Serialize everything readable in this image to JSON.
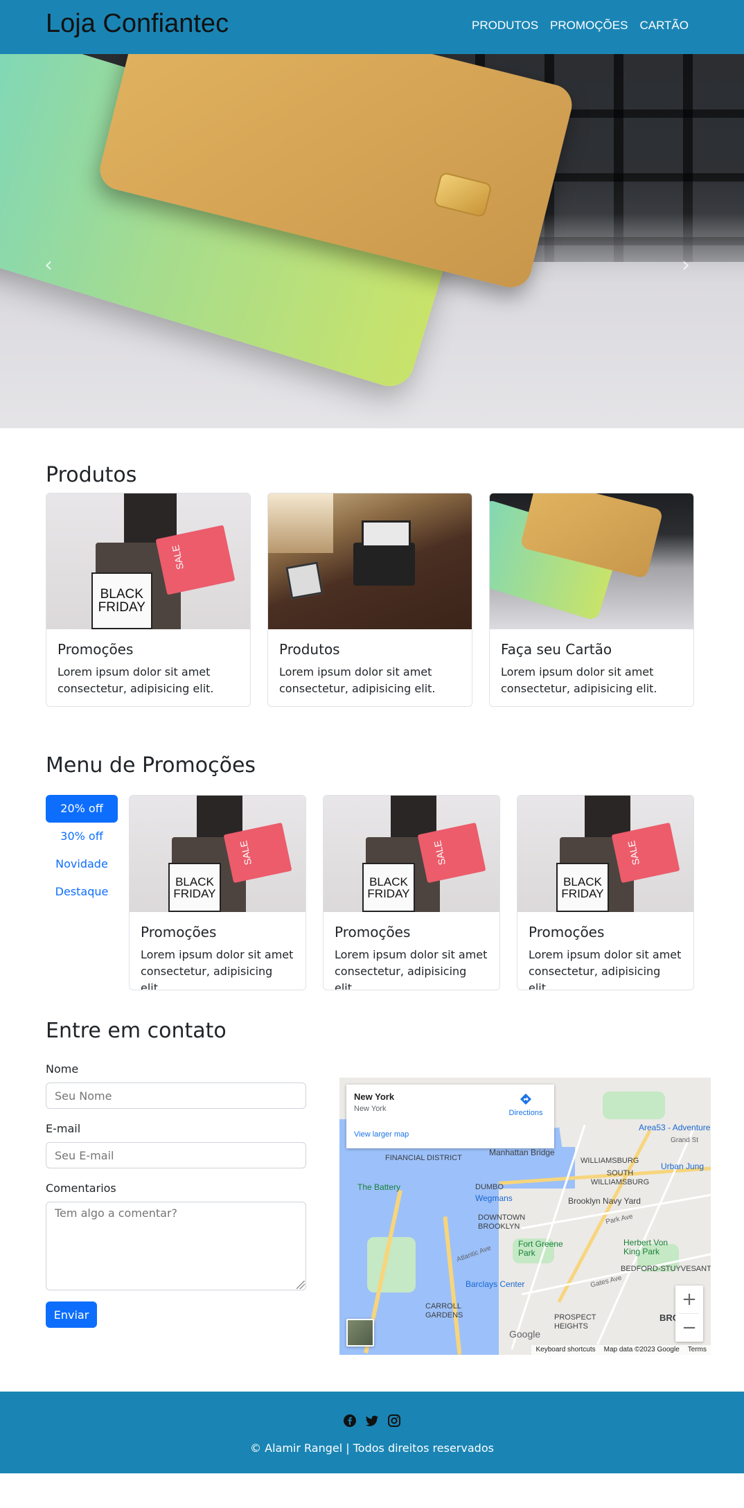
{
  "header": {
    "brand": "Loja Confiantec",
    "nav": [
      "PRODUTOS",
      "PROMOÇÕES",
      "CARTÃO"
    ]
  },
  "hero": {
    "prev_glyph": "‹",
    "next_glyph": "›"
  },
  "produtos": {
    "heading": "Produtos",
    "cards": [
      {
        "title": "Promoções",
        "text": "Lorem ipsum dolor sit amet consectetur, adipisicing elit.",
        "image_text": "BLACK FRIDAY",
        "sale": "SALE"
      },
      {
        "title": "Produtos",
        "text": "Lorem ipsum dolor sit amet consectetur, adipisicing elit."
      },
      {
        "title": "Faça seu Cartão",
        "text": "Lorem ipsum dolor sit amet consectetur, adipisicing elit."
      }
    ]
  },
  "promocoes": {
    "heading": "Menu de Promoções",
    "pills": [
      "20% off",
      "30% off",
      "Novidade",
      "Destaque"
    ],
    "active_pill": "20% off",
    "cards": [
      {
        "title": "Promoções",
        "text": "Lorem ipsum dolor sit amet consectetur, adipisicing elit.",
        "image_text": "BLACK FRIDAY",
        "sale": "SALE"
      },
      {
        "title": "Promoções",
        "text": "Lorem ipsum dolor sit amet consectetur, adipisicing elit.",
        "image_text": "BLACK FRIDAY",
        "sale": "SALE"
      },
      {
        "title": "Promoções",
        "text": "Lorem ipsum dolor sit amet consectetur, adipisicing elit.",
        "image_text": "BLACK FRIDAY",
        "sale": "SALE"
      }
    ]
  },
  "contato": {
    "heading": "Entre em contato",
    "nome_label": "Nome",
    "nome_placeholder": "Seu Nome",
    "email_label": "E-mail",
    "email_placeholder": "Seu E-mail",
    "comentarios_label": "Comentarios",
    "comentarios_placeholder": "Tem algo a comentar?",
    "submit": "Enviar"
  },
  "map": {
    "place_title": "New York",
    "place_subtitle": "New York",
    "directions": "Directions",
    "view_larger": "View larger map",
    "zoom_in": "+",
    "zoom_out": "−",
    "labels": [
      "Manhattan Bridge",
      "FINANCIAL DISTRICT",
      "The Battery",
      "DUMBO",
      "Wegmans",
      "Brooklyn Navy Yard",
      "DOWNTOWN BROOKLYN",
      "Fort Greene Park",
      "WILLIAMSBURG",
      "SOUTH WILLIAMSBURG",
      "Area53 - Adventure",
      "Urban Jung",
      "Herbert Von King Park",
      "BEDFORD-STUYVESANT",
      "Barclays Center",
      "CARROLL GARDENS",
      "PROSPECT HEIGHTS",
      "BROOK",
      "Atlantic Ave",
      "Park Ave",
      "Gates Ave",
      "Grand St"
    ],
    "google": "Google",
    "footer": [
      "Keyboard shortcuts",
      "Map data ©2023 Google",
      "Terms"
    ]
  },
  "footer": {
    "copyright": "© Alamir Rangel | Todos direitos reservados",
    "social": [
      "facebook-icon",
      "twitter-icon",
      "instagram-icon"
    ]
  },
  "colors": {
    "brand_bar": "#1a85b5",
    "primary": "#0d6efd"
  }
}
